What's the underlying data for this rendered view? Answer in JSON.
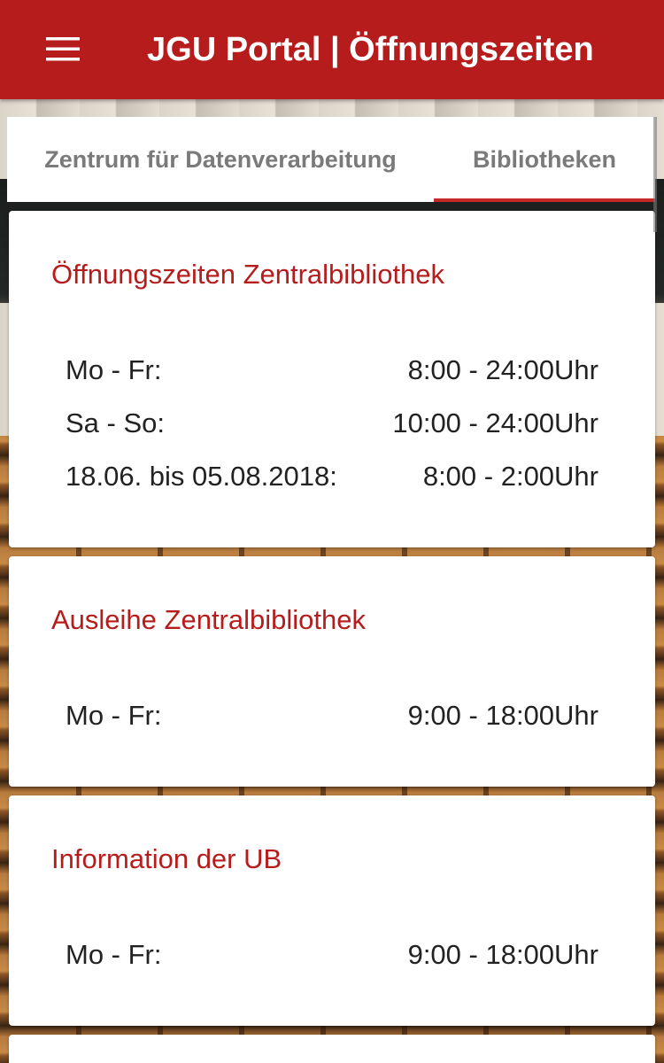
{
  "appbar": {
    "title": "JGU Portal | Öffnungszeiten",
    "menu_icon": "hamburger-menu-icon",
    "color": "#b71c1c"
  },
  "tabs": [
    {
      "label": "Zentrum für Datenverarbeitung",
      "selected": false
    },
    {
      "label": "Bibliotheken",
      "selected": true
    }
  ],
  "accent_color": "#c62828",
  "cards": [
    {
      "title": "Öffnungszeiten Zentralbibliothek",
      "rows": [
        {
          "day": "Mo - Fr:",
          "time": "8:00 - 24:00Uhr"
        },
        {
          "day": "Sa - So:",
          "time": "10:00 - 24:00Uhr"
        },
        {
          "day": "18.06. bis 05.08.2018:",
          "time": "8:00 - 2:00Uhr"
        }
      ]
    },
    {
      "title": "Ausleihe Zentralbibliothek",
      "rows": [
        {
          "day": "Mo - Fr:",
          "time": "9:00 - 18:00Uhr"
        }
      ]
    },
    {
      "title": "Information der UB",
      "rows": [
        {
          "day": "Mo - Fr:",
          "time": "9:00 - 18:00Uhr"
        }
      ]
    }
  ]
}
